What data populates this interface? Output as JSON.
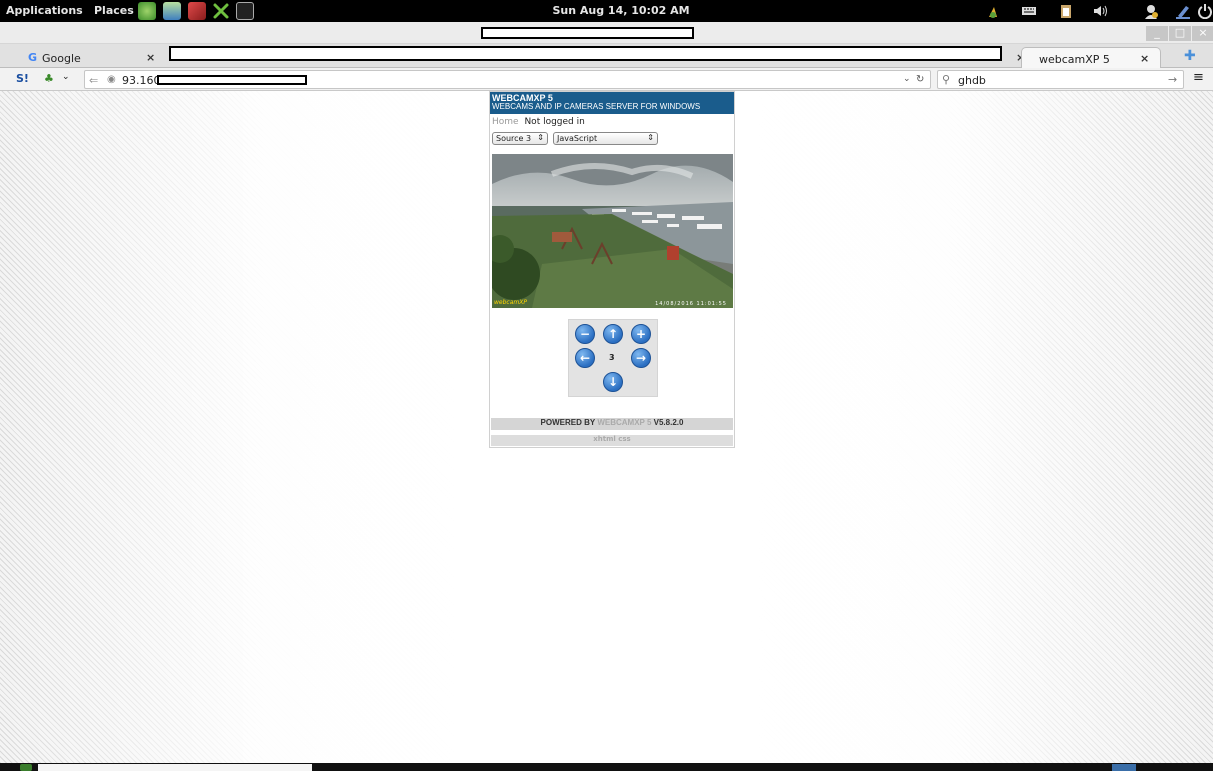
{
  "panel": {
    "applications": "Applications",
    "places": "Places",
    "clock": "Sun Aug 14, 10:02 AM",
    "launchers": [
      "globe-icon",
      "image-viewer-icon",
      "ruby-icon",
      "tools-icon",
      "terminal-icon"
    ],
    "tray": [
      "hp-icon",
      "keyboard-icon",
      "clipboard-icon",
      "volume-icon",
      "user-icon",
      "pencil-icon",
      "power-icon"
    ]
  },
  "window": {
    "controls": [
      "_",
      "□",
      "×"
    ]
  },
  "tabs": [
    {
      "label": "Google",
      "close": "×"
    },
    {
      "label": "webcamXP 5",
      "close": "×"
    }
  ],
  "redacted_tab_close": "×",
  "nav": {
    "url": "93.160",
    "search_value": "ghdb"
  },
  "webcam": {
    "title": "WEBCAMXP 5",
    "subtitle": "WEBCAMS AND IP CAMERAS SERVER FOR WINDOWS",
    "home_link": "Home",
    "login_status": "Not logged in",
    "source_select": "Source 3",
    "mode_select": "JavaScript",
    "camera_brand": "webcamXP",
    "camera_timestamp": "14/08/2016 11:01:55",
    "preset_number": "3",
    "powered_prefix": "POWERED BY",
    "powered_brand": "WEBCAMXP 5",
    "version": "V5.8.2.0",
    "footer_links": "xhtml css"
  },
  "colors": {
    "header_bg": "#1a5c8c",
    "ptz_blue": "#2b6fc2"
  }
}
